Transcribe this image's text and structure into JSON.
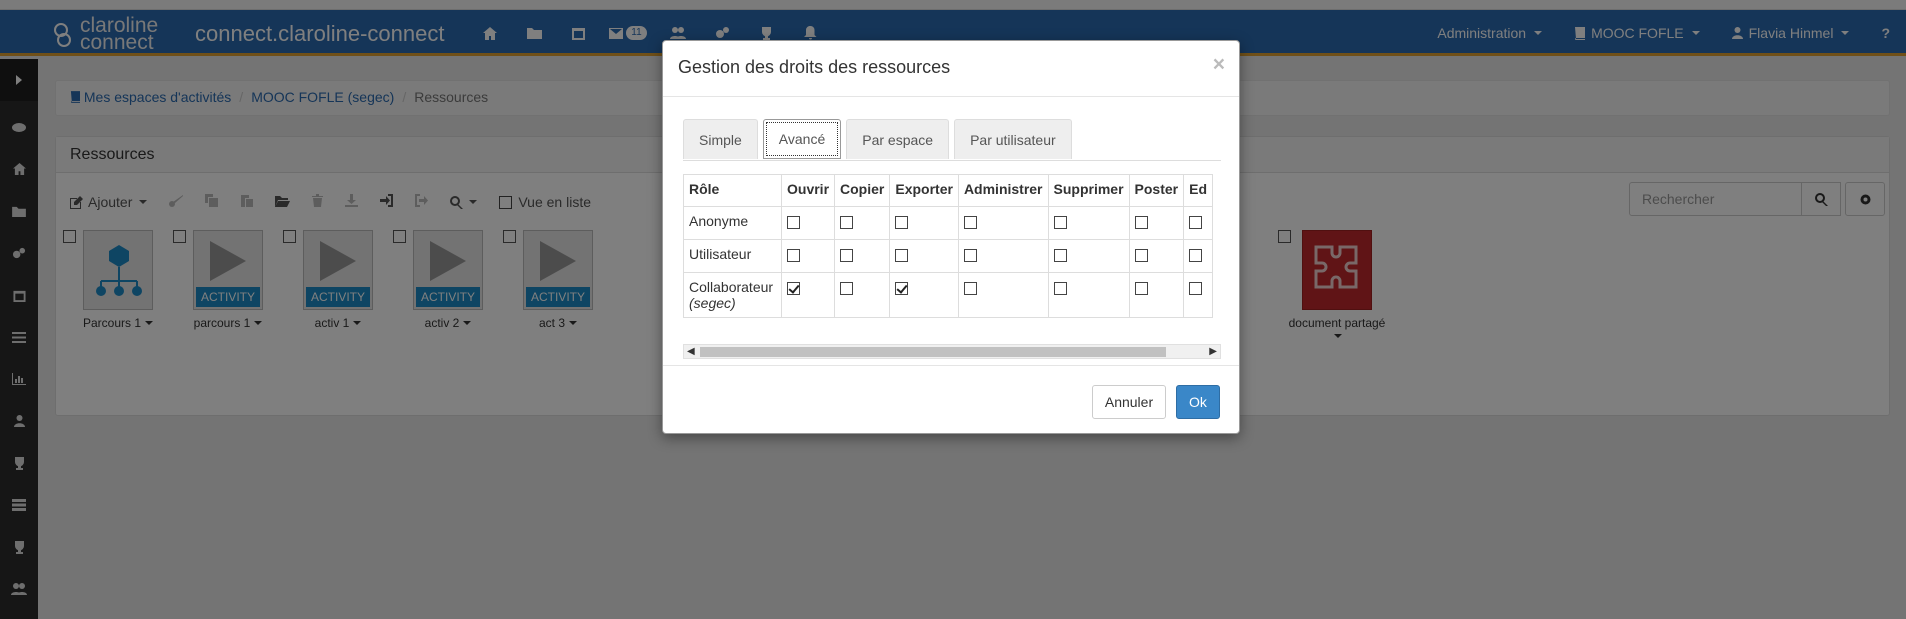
{
  "navbar": {
    "logo_line1": "claroline",
    "logo_line2": "connect",
    "brand": "connect.claroline-connect",
    "mail_count": "11",
    "icons": [
      "home-icon",
      "folder-icon",
      "calendar-icon",
      "envelope-icon",
      "users-icon",
      "cogs-icon",
      "trophy-icon",
      "bell-icon"
    ],
    "admin_label": "Administration",
    "workspace_label": "MOOC FOFLE",
    "user_label": "Flavia Hinmel",
    "help_label": "?"
  },
  "breadcrumb": {
    "item1": "Mes espaces d'activités",
    "item2": "MOOC FOFLE (segec)",
    "item3": "Ressources"
  },
  "panel": {
    "title": "Ressources",
    "add_label": "Ajouter",
    "list_view_label": "Vue en liste",
    "search_placeholder": "Rechercher"
  },
  "resources": [
    {
      "name": "Parcours 1",
      "tag": ""
    },
    {
      "name": "parcours 1",
      "tag": "ACTIVITY"
    },
    {
      "name": "activ 1",
      "tag": "ACTIVITY"
    },
    {
      "name": "activ 2",
      "tag": "ACTIVITY"
    },
    {
      "name": "act 3",
      "tag": "ACTIVITY"
    },
    {
      "name": "document partagé",
      "tag": ""
    }
  ],
  "modal": {
    "title": "Gestion des droits des ressources",
    "close": "×",
    "tabs": [
      "Simple",
      "Avancé",
      "Par espace",
      "Par utilisateur"
    ],
    "active_tab": "Avancé",
    "columns": [
      "Rôle",
      "Ouvrir",
      "Copier",
      "Exporter",
      "Administrer",
      "Supprimer",
      "Poster",
      "Ed"
    ],
    "rows": [
      {
        "role": "Anonyme",
        "role_sub": "",
        "checks": [
          false,
          false,
          false,
          false,
          false,
          false,
          false
        ]
      },
      {
        "role": "Utilisateur",
        "role_sub": "",
        "checks": [
          false,
          false,
          false,
          false,
          false,
          false,
          false
        ]
      },
      {
        "role": "Collaborateur",
        "role_sub": "(segec)",
        "checks": [
          true,
          false,
          true,
          false,
          false,
          false,
          false
        ]
      }
    ],
    "cancel_label": "Annuler",
    "ok_label": "Ok"
  },
  "colors": {
    "navbar": "#2a6ab0",
    "accent_stripe": "#e0a030",
    "primary_button": "#3a87c8",
    "activity_tag": "#1c8ac6"
  }
}
